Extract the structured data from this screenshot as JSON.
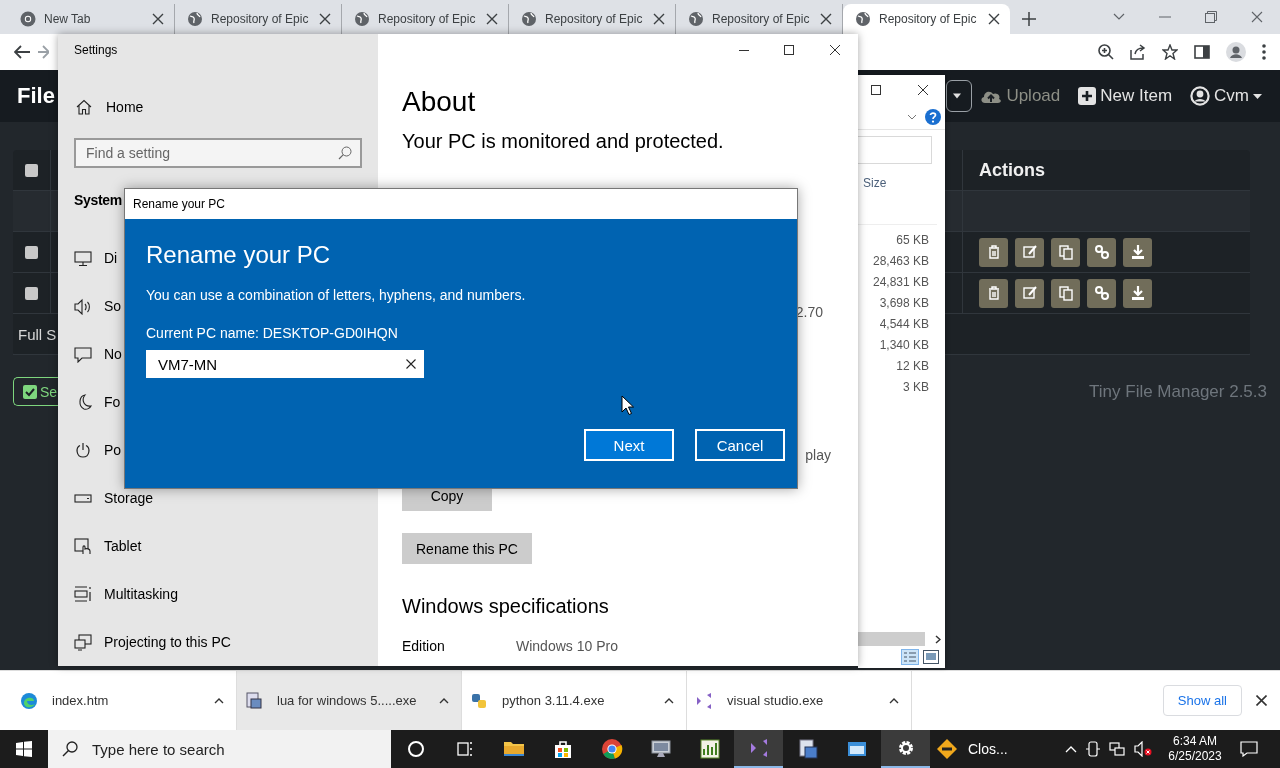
{
  "browser": {
    "tabs": [
      {
        "kind": "newtab",
        "title": "New Tab",
        "selected": false
      },
      {
        "kind": "page",
        "title": "Repository of Epic",
        "selected": false
      },
      {
        "kind": "page",
        "title": "Repository of Epic",
        "selected": false
      },
      {
        "kind": "page",
        "title": "Repository of Epic",
        "selected": false
      },
      {
        "kind": "page",
        "title": "Repository of Epic",
        "selected": false
      },
      {
        "kind": "page",
        "title": "Repository of Epic",
        "selected": true
      }
    ]
  },
  "web_page": {
    "brand": "File",
    "nav": [
      {
        "kind": "upload",
        "label": "Upload",
        "disabled": true
      },
      {
        "kind": "new",
        "label": "New Item",
        "disabled": false
      },
      {
        "kind": "user",
        "label": "Cvm",
        "disabled": false
      }
    ],
    "table": {
      "actions_header": "Actions",
      "rows": [
        {
          "kind": "header",
          "checked": false
        },
        {
          "kind": "parent"
        },
        {
          "kind": "file",
          "checked": false
        },
        {
          "kind": "file",
          "checked": false
        },
        {
          "kind": "summary",
          "text": "Full S"
        }
      ]
    },
    "select_button": "Se",
    "version": "Tiny File Manager 2.5.3"
  },
  "explorer": {
    "size_header": "Size",
    "sizes": [
      "65 KB",
      "28,463 KB",
      "24,831 KB",
      "3,698 KB",
      "4,544 KB",
      "1,340 KB",
      "12 KB",
      "3 KB"
    ]
  },
  "settings": {
    "title": "Settings",
    "home": "Home",
    "search_placeholder": "Find a setting",
    "section": "System",
    "nav_items": [
      {
        "kind": "display",
        "label": "Di"
      },
      {
        "kind": "sound",
        "label": "So"
      },
      {
        "kind": "notifications",
        "label": "No"
      },
      {
        "kind": "focus",
        "label": "Fo"
      },
      {
        "kind": "power",
        "label": "Po"
      },
      {
        "kind": "storage",
        "label": "Storage"
      },
      {
        "kind": "tablet",
        "label": "Tablet"
      },
      {
        "kind": "multitasking",
        "label": "Multitasking"
      },
      {
        "kind": "projecting",
        "label": "Projecting to this PC"
      }
    ],
    "heading": "About",
    "status": "Your PC is monitored and protected.",
    "fragments": [
      "2.70",
      "play"
    ],
    "buttons": [
      "Copy",
      "Rename this PC"
    ],
    "spec_heading": "Windows specifications",
    "specs": [
      {
        "label": "Edition",
        "value": "Windows 10 Pro"
      }
    ]
  },
  "dialog": {
    "title": "Rename your PC",
    "heading": "Rename your PC",
    "description": "You can use a combination of letters, hyphens, and numbers.",
    "current_name": "Current PC name: DESKTOP-GD0IHQN",
    "value": "VM7-MN",
    "buttons": [
      {
        "kind": "primary",
        "label": "Next"
      },
      {
        "kind": "secondary",
        "label": "Cancel"
      }
    ]
  },
  "downloads": {
    "items": [
      {
        "kind": "edge",
        "name": "index.htm",
        "selected": false
      },
      {
        "kind": "installer",
        "name": "lua for windows 5.....exe",
        "selected": true
      },
      {
        "kind": "python",
        "name": "python 3.11.4.exe",
        "selected": false
      },
      {
        "kind": "vs",
        "name": "visual studio.exe",
        "selected": false
      }
    ],
    "show_all": "Show all"
  },
  "taskbar": {
    "search_placeholder": "Type here to search",
    "apps": [
      {
        "kind": "folder",
        "highlighted": false
      },
      {
        "kind": "store",
        "highlighted": false
      },
      {
        "kind": "chrome",
        "highlighted": false
      },
      {
        "kind": "monitor",
        "highlighted": false
      },
      {
        "kind": "chart",
        "highlighted": false
      },
      {
        "kind": "vs",
        "highlighted": true
      },
      {
        "kind": "installer",
        "highlighted": false
      },
      {
        "kind": "window",
        "highlighted": false
      },
      {
        "kind": "gear",
        "highlighted": true
      }
    ],
    "weather": "Clos...",
    "time": "6:34 AM",
    "date": "6/25/2023"
  }
}
